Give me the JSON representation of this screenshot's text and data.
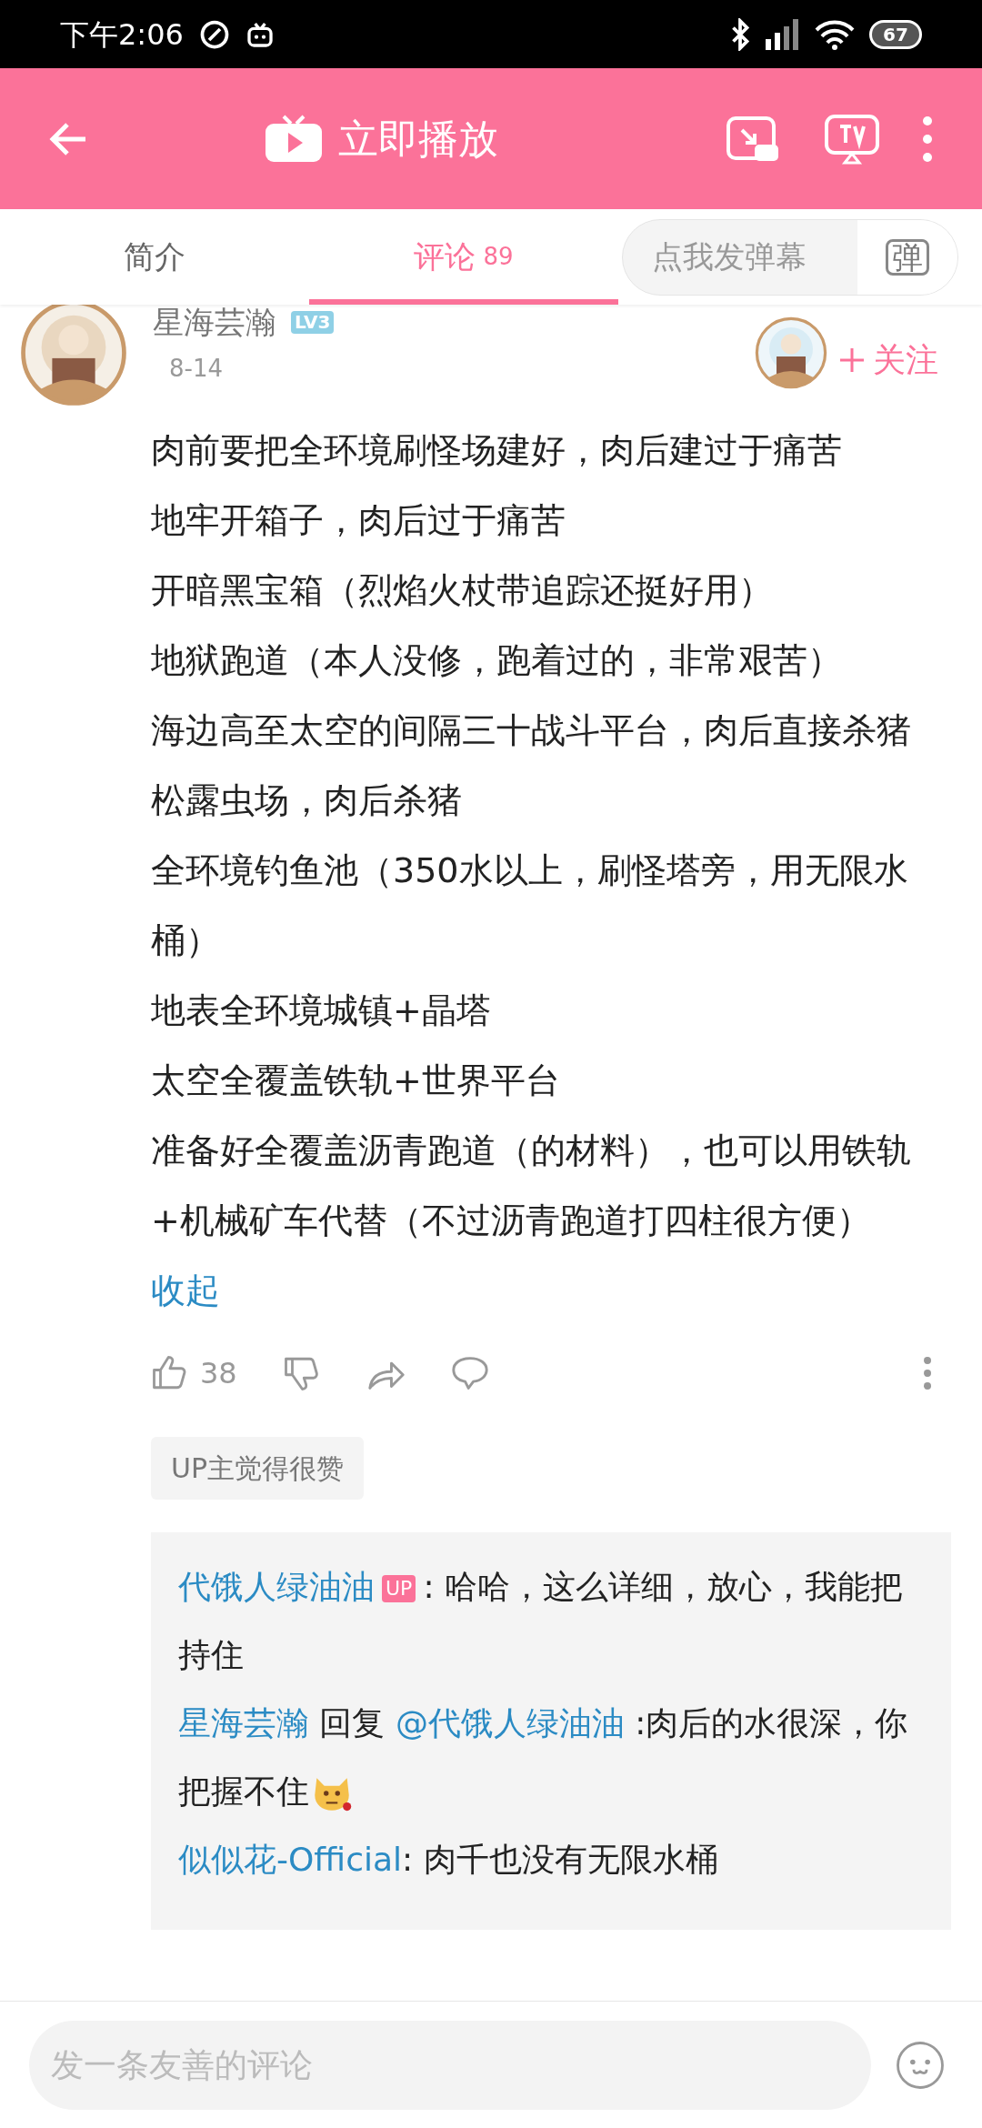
{
  "status_bar": {
    "time": "下午2:06",
    "battery": "67"
  },
  "header": {
    "title": "立即播放"
  },
  "tabs": [
    {
      "label": "简介",
      "selected": false
    },
    {
      "label": "评论",
      "count": "89",
      "selected": true
    }
  ],
  "danmaku": {
    "placeholder": "点我发弹幕",
    "button": "弹"
  },
  "comment": {
    "user": "星海芸瀚",
    "level": "LV3",
    "date": "8-14",
    "follow": "关注",
    "lines": [
      "肉前要把全环境刷怪场建好，肉后建过于痛苦",
      "地牢开箱子，肉后过于痛苦",
      "开暗黑宝箱（烈焰火杖带追踪还挺好用）",
      "地狱跑道（本人没修，跑着过的，非常艰苦）",
      "海边高至太空的间隔三十战斗平台，肉后直接杀猪",
      "松露虫场，肉后杀猪",
      "全环境钓鱼池（350水以上，刷怪塔旁，用无限水桶）",
      "地表全环境城镇+晶塔",
      "太空全覆盖铁轨+世界平台",
      "准备好全覆盖沥青跑道（的材料），也可以用铁轨+机械矿车代替（不过沥青跑道打四柱很方便）"
    ],
    "collapse": "收起",
    "likes": "38",
    "badge": "UP主觉得很赞",
    "replies": [
      {
        "user": "代饿人绿油油",
        "up_badge": "UP",
        "text": ": 哈哈，这么详细，放心，我能把持住"
      },
      {
        "user": "星海芸瀚",
        "reply_word": "回复",
        "target": "@代饿人绿油油",
        "text": ":肉后的水很深，你把握不住",
        "emoji": true
      },
      {
        "user": "似似花-Official",
        "text": ": 肉千也没有无限水桶"
      }
    ]
  },
  "input": {
    "placeholder": "发一条友善的评论"
  }
}
